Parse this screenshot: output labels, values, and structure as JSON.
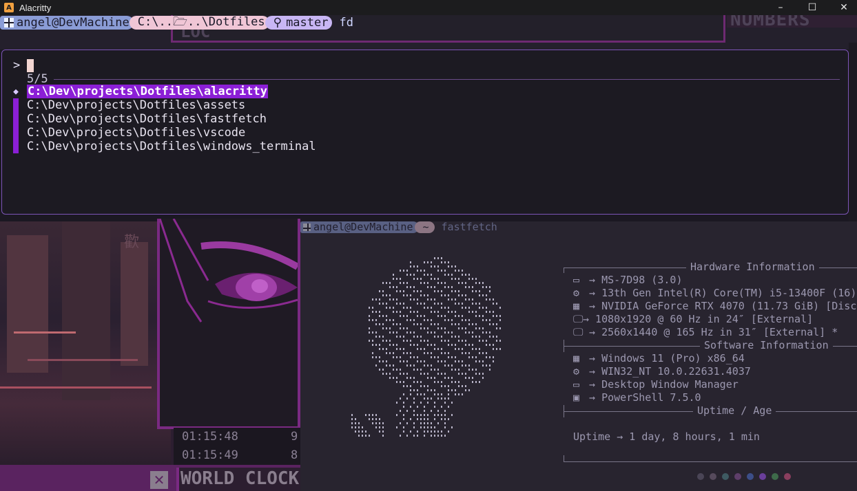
{
  "window": {
    "title": "Alacritty",
    "min_glyph": "–",
    "max_glyph": "☐",
    "close_glyph": "✕",
    "icon_letter": "A"
  },
  "prompt": {
    "user": "angel@DevMachine",
    "path": "C:\\..🗁..\\Dotfiles",
    "branch": "master",
    "branch_glyph": "⚲",
    "command": "fd"
  },
  "picker": {
    "prompt_symbol": ">",
    "query": "",
    "count": "5/5",
    "selected_marker": "◆",
    "results": [
      "C:\\Dev\\projects\\Dotfiles\\alacritty",
      "C:\\Dev\\projects\\Dotfiles\\assets",
      "C:\\Dev\\projects\\Dotfiles\\fastfetch",
      "C:\\Dev\\projects\\Dotfiles\\vscode",
      "C:\\Dev\\projects\\Dotfiles\\windows_terminal"
    ],
    "selected_index": 0
  },
  "fastfetch_prompt": {
    "user": "angel@DevMachine",
    "home": "~",
    "command": "fastfetch"
  },
  "hardware": {
    "header": "Hardware Information",
    "rows": [
      {
        "icon": "laptop-icon",
        "glyph": "▭",
        "text": "→ MS-7D98 (3.0)"
      },
      {
        "icon": "cpu-icon",
        "glyph": "⚙",
        "text": "→ 13th Gen Intel(R) Core(TM) i5-13400F (16)"
      },
      {
        "icon": "gpu-icon",
        "glyph": "▦",
        "text": "→ NVIDIA GeForce RTX 4070 (11.73 GiB) [Disc"
      },
      {
        "icon": "monitor-icon",
        "glyph": "🖵",
        "text": "→ 1080x1920 @ 60 Hz in 24″ [External]"
      },
      {
        "icon": "monitor-icon",
        "glyph": "🖵",
        "text": "→ 2560x1440 @ 165 Hz in 31″ [External] *"
      }
    ]
  },
  "software": {
    "header": "Software Information",
    "rows": [
      {
        "icon": "windows-icon",
        "glyph": "▦",
        "text": "→ Windows 11 (Pro) x86_64"
      },
      {
        "icon": "gear-icon",
        "glyph": "⚙",
        "text": "→ WIN32_NT 10.0.22631.4037"
      },
      {
        "icon": "window-manager-icon",
        "glyph": "▭",
        "text": "→ Desktop Window Manager"
      },
      {
        "icon": "terminal-icon",
        "glyph": "▣",
        "text": "→ PowerShell 7.5.0"
      }
    ]
  },
  "uptime": {
    "header": "Uptime / Age",
    "label": "Uptime",
    "value": "→ 1 day, 8 hours, 1 min"
  },
  "color_dots": [
    "#4a4556",
    "#564a5c",
    "#3e5a62",
    "#5e3e6a",
    "#3c4e88",
    "#6a3e9a",
    "#3e6a4a",
    "#8a3e5e"
  ],
  "background_widgets": {
    "numbers_text": "NUMBERS",
    "location_text": "LOC",
    "clock_lines": [
      "01:15:48",
      "01:15:49"
    ],
    "clock_right": [
      "9",
      "8"
    ],
    "close_glyph": "✕",
    "world_clock": "WORLD CLOCK",
    "kanji": "歡"
  }
}
